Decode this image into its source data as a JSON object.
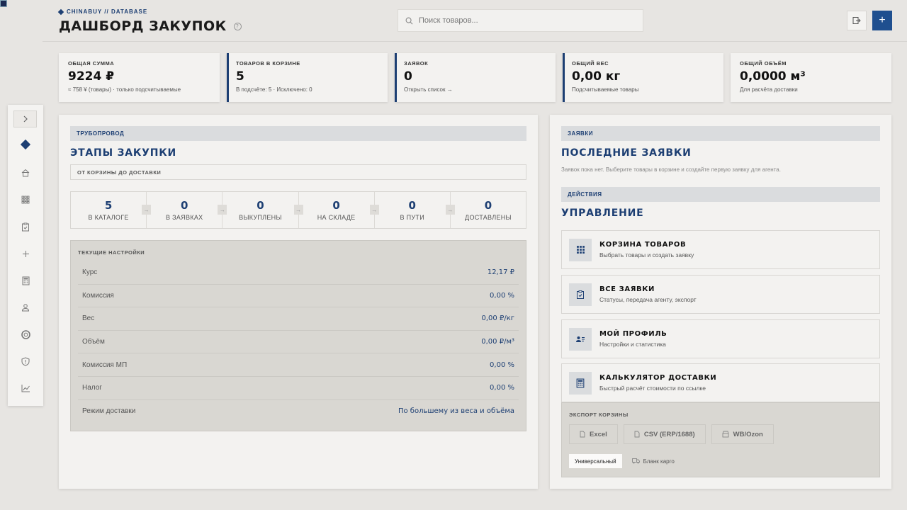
{
  "header": {
    "brand": "CHINABUY // DATABASE",
    "title": "ДАШБОРД ЗАКУПОК",
    "help": "?",
    "search_placeholder": "Поиск товаров..."
  },
  "stats": [
    {
      "label": "ОБЩАЯ СУММА",
      "value": "9224 ₽",
      "sub": "≈ 758 ¥ (товары) · только подсчитываемые"
    },
    {
      "label": "ТОВАРОВ В КОРЗИНЕ",
      "value": "5",
      "sub": "В подсчёте: 5 · Исключено: 0"
    },
    {
      "label": "ЗАЯВОК",
      "value": "0",
      "sub": "Открыть список →"
    },
    {
      "label": "ОБЩИЙ ВЕС",
      "value": "0,00 кг",
      "sub": "Подсчитываемые товары"
    },
    {
      "label": "ОБЩИЙ ОБЪЁМ",
      "value": "0,0000 м³",
      "sub": "Для расчёта доставки"
    }
  ],
  "pipeline": {
    "tag": "ТРУБОПРОВОД",
    "title": "ЭТАПЫ ЗАКУПКИ",
    "subtitle": "ОТ КОРЗИНЫ ДО ДОСТАВКИ",
    "arrow": "→",
    "stages": [
      {
        "count": "5",
        "label": "В КАТАЛОГЕ"
      },
      {
        "count": "0",
        "label": "В ЗАЯВКАХ"
      },
      {
        "count": "0",
        "label": "ВЫКУПЛЕНЫ"
      },
      {
        "count": "0",
        "label": "НА СКЛАДЕ"
      },
      {
        "count": "0",
        "label": "В ПУТИ"
      },
      {
        "count": "0",
        "label": "ДОСТАВЛЕНЫ"
      }
    ]
  },
  "settings": {
    "title": "ТЕКУЩИЕ НАСТРОЙКИ",
    "rows": [
      {
        "name": "Курс",
        "value": "12,17 ₽"
      },
      {
        "name": "Комиссия",
        "value": "0,00 %"
      },
      {
        "name": "Вес",
        "value": "0,00 ₽/кг"
      },
      {
        "name": "Объём",
        "value": "0,00 ₽/м³"
      },
      {
        "name": "Комиссия МП",
        "value": "0,00 %"
      },
      {
        "name": "Налог",
        "value": "0,00 %"
      },
      {
        "name": "Режим доставки",
        "value": "По большему из веса и объёма"
      }
    ]
  },
  "orders": {
    "tag": "ЗАЯВКИ",
    "title": "ПОСЛЕДНИЕ ЗАЯВКИ",
    "empty": "Заявок пока нет. Выберите товары в корзине и создайте первую заявку для агента."
  },
  "actions": {
    "tag": "ДЕЙСТВИЯ",
    "title": "УПРАВЛЕНИЕ",
    "items": [
      {
        "title": "КОРЗИНА ТОВАРОВ",
        "sub": "Выбрать товары и создать заявку",
        "icon": "grid-icon"
      },
      {
        "title": "ВСЕ ЗАЯВКИ",
        "sub": "Статусы, передача агенту, экспорт",
        "icon": "clipboard-icon"
      },
      {
        "title": "МОЙ ПРОФИЛЬ",
        "sub": "Настройки и статистика",
        "icon": "profile-card-icon"
      },
      {
        "title": "КАЛЬКУЛЯТОР ДОСТАВКИ",
        "sub": "Быстрый расчёт стоимости по ссылке",
        "icon": "calculator-icon"
      }
    ]
  },
  "export": {
    "title": "ЭКСПОРТ КОРЗИНЫ",
    "buttons": [
      "Excel",
      "CSV (ERP/1688)",
      "WB/Ozon"
    ],
    "modes": [
      "Универсальный",
      "Бланк карго"
    ]
  },
  "colors": {
    "accent": "#1d3f73",
    "background": "#e7e5e2",
    "card": "#f3f2f0"
  }
}
